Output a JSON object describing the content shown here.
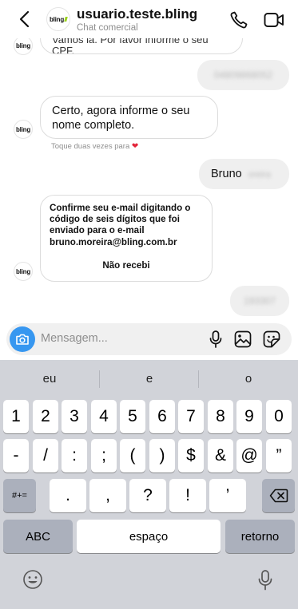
{
  "header": {
    "title": "usuario.teste.bling",
    "subtitle": "Chat comercial",
    "logo_text": "bling"
  },
  "messages": {
    "m1_text": "Vamos lá. Por favor informe o seu CPF.",
    "out1_text": "04809868052",
    "m2_text": "Certo, agora informe o seu nome completo.",
    "reaction_text": "Toque duas vezes para",
    "out2_text": "Bruno",
    "out2_blur": "oreira",
    "m3_text": "Confirme seu e-mail digitando o código de seis dígitos que foi enviado para o e-mail bruno.moreira@bling.com.br",
    "m3_action": "Não recebi",
    "out3_text": "193307"
  },
  "composer": {
    "placeholder": "Mensagem..."
  },
  "keyboard": {
    "suggestions": [
      "eu",
      "e",
      "o"
    ],
    "row1": [
      "1",
      "2",
      "3",
      "4",
      "5",
      "6",
      "7",
      "8",
      "9",
      "0"
    ],
    "row2": [
      "-",
      "/",
      ":",
      ";",
      "(",
      ")",
      "$",
      "&",
      "@",
      "”"
    ],
    "row3_left": "#+=",
    "row3": [
      ".",
      ",",
      "?",
      "!",
      "’"
    ],
    "abc": "ABC",
    "space": "espaço",
    "return": "retorno"
  },
  "icons": {
    "back": "chevron-left-icon",
    "call": "phone-icon",
    "video": "video-icon",
    "camera": "camera-icon",
    "mic": "mic-icon",
    "gallery": "image-icon",
    "sticker": "sticker-icon",
    "backspace": "backspace-icon",
    "emoji": "emoji-icon",
    "dictation": "dictation-icon"
  },
  "colors": {
    "accent": "#3797f0",
    "outgoing_bubble": "#efefef",
    "keyboard_bg": "#d1d3d9",
    "heart": "#e3263b"
  }
}
